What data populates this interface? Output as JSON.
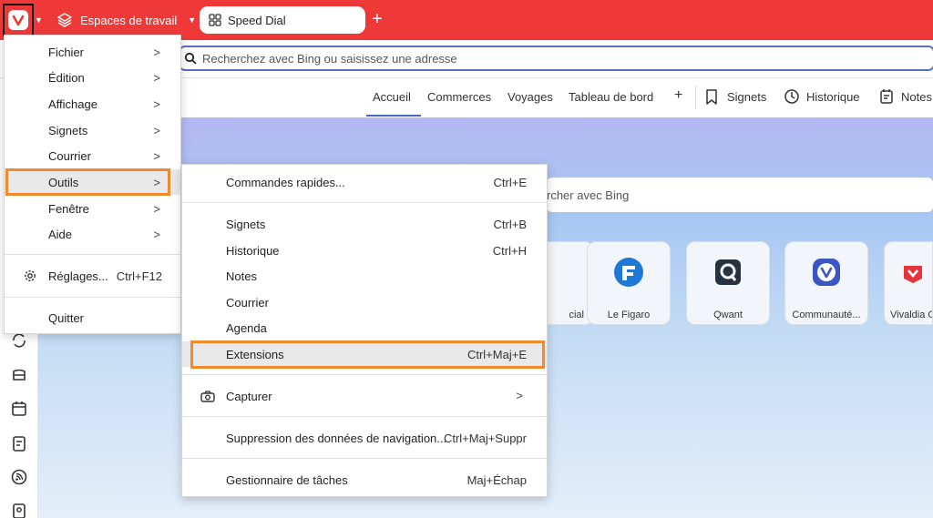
{
  "titlebar": {
    "workspaces_label": "Espaces de travail",
    "tab_label": "Speed Dial"
  },
  "address": {
    "placeholder": "Recherchez avec Bing ou saisissez une adresse"
  },
  "speeddial_nav": {
    "items": [
      "Accueil",
      "Commerces",
      "Voyages",
      "Tableau de bord"
    ],
    "active": "Accueil",
    "add": "+",
    "panels": [
      "Signets",
      "Historique",
      "Notes"
    ]
  },
  "page": {
    "search_placeholder": "rcher avec Bing",
    "tiles": [
      {
        "label": "cial",
        "icon": "social-icon"
      },
      {
        "label": "Le Figaro",
        "icon": "le-figaro-icon"
      },
      {
        "label": "Qwant",
        "icon": "qwant-icon"
      },
      {
        "label": "Communauté...",
        "icon": "vivaldi-community-icon"
      },
      {
        "label": "Vivaldia G",
        "icon": "vivaldia-icon"
      }
    ]
  },
  "main_menu": {
    "items": [
      {
        "label": "Fichier"
      },
      {
        "label": "Édition"
      },
      {
        "label": "Affichage"
      },
      {
        "label": "Signets"
      },
      {
        "label": "Courrier"
      },
      {
        "label": "Outils"
      },
      {
        "label": "Fenêtre"
      },
      {
        "label": "Aide"
      }
    ],
    "settings_label": "Réglages...",
    "settings_shortcut": "Ctrl+F12",
    "quit_label": "Quitter"
  },
  "tools_menu": {
    "items": [
      {
        "label": "Commandes rapides...",
        "shortcut": "Ctrl+E"
      },
      {
        "label": "Signets",
        "shortcut": "Ctrl+B"
      },
      {
        "label": "Historique",
        "shortcut": "Ctrl+H"
      },
      {
        "label": "Notes",
        "shortcut": ""
      },
      {
        "label": "Courrier",
        "shortcut": ""
      },
      {
        "label": "Agenda",
        "shortcut": ""
      },
      {
        "label": "Extensions",
        "shortcut": "Ctrl+Maj+E"
      },
      {
        "label": "Capturer",
        "shortcut": ""
      },
      {
        "label": "Suppression des données de navigation...",
        "shortcut": "Ctrl+Maj+Suppr"
      },
      {
        "label": "Gestionnaire de tâches",
        "shortcut": "Maj+Échap"
      }
    ]
  },
  "colors": {
    "brand": "#ef3939",
    "highlight_outline": "#f08a2c",
    "active_tab": "#4a64c8"
  }
}
